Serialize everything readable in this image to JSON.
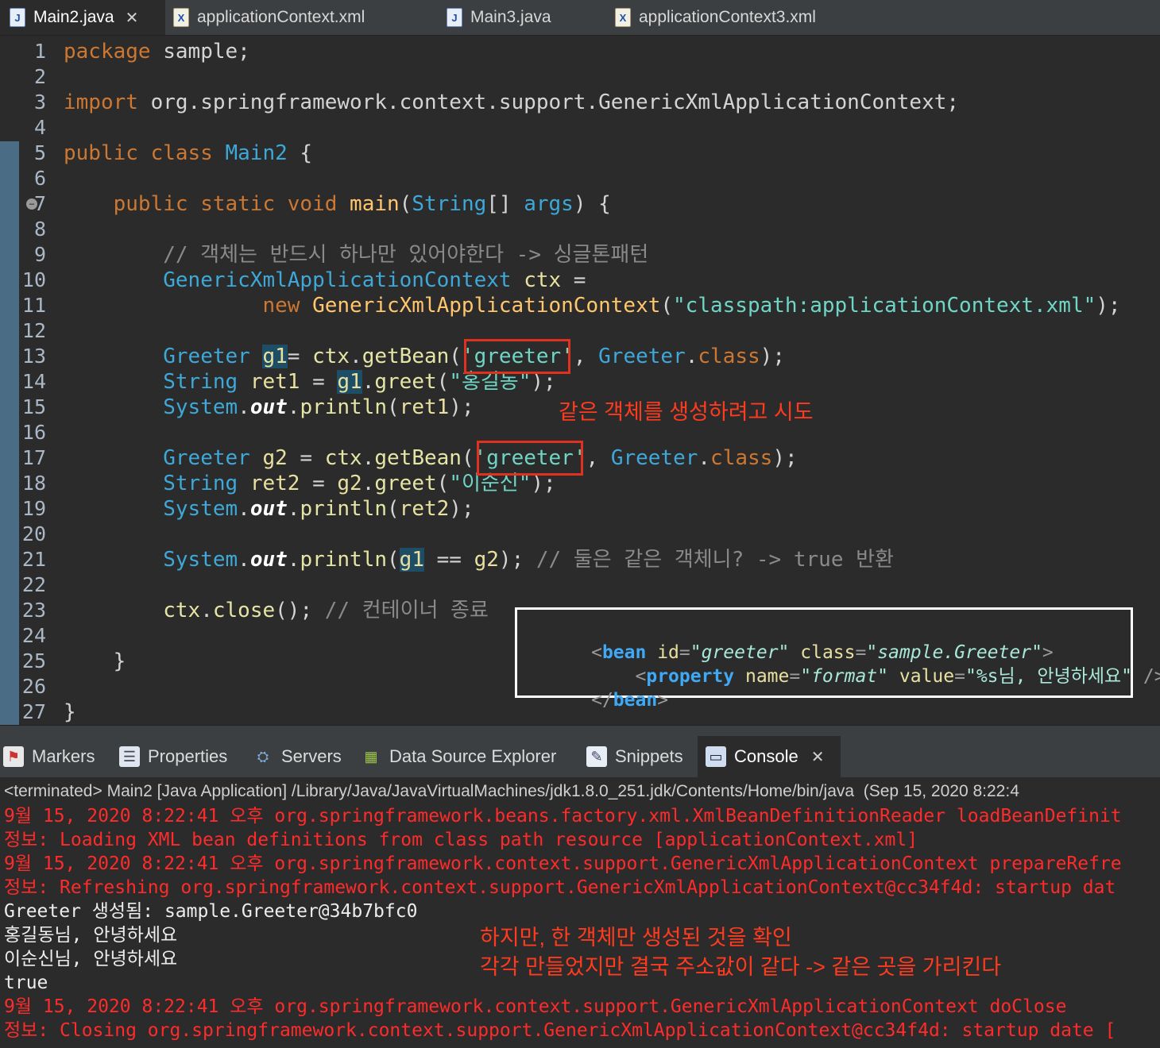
{
  "editor_tabs": [
    {
      "label": "Main2.java",
      "icon": "java-file-icon",
      "active": true
    },
    {
      "label": "applicationContext.xml",
      "icon": "xml-file-icon",
      "active": false
    },
    {
      "label": "Main3.java",
      "icon": "java-file-icon",
      "active": false
    },
    {
      "label": "applicationContext3.xml",
      "icon": "xml-file-icon",
      "active": false
    }
  ],
  "line_numbers": [
    "1",
    "2",
    "3",
    "4",
    "5",
    "6",
    "7",
    "8",
    "9",
    "10",
    "11",
    "12",
    "13",
    "14",
    "15",
    "16",
    "17",
    "18",
    "19",
    "20",
    "21",
    "22",
    "23",
    "24",
    "25",
    "26",
    "27"
  ],
  "code": {
    "l1": [
      "package",
      " sample;"
    ],
    "l3": [
      "import",
      " org.springframework.context.support.GenericXmlApplicationContext;"
    ],
    "l5": [
      "public class",
      " ",
      "Main2",
      " {"
    ],
    "l7": [
      "    ",
      "public static void",
      " ",
      "main",
      "(",
      "String",
      "[] ",
      "args",
      ") {"
    ],
    "l9": [
      "        // 객체는 반드시 하나만 있어야한다 -> 싱글톤패턴"
    ],
    "l10": [
      "        ",
      "GenericXmlApplicationContext",
      " ",
      "ctx",
      " ="
    ],
    "l11": [
      "                ",
      "new",
      " ",
      "GenericXmlApplicationContext",
      "(",
      "\"classpath:applicationContext.xml\"",
      ");"
    ],
    "l13": [
      "        ",
      "Greeter",
      " ",
      "g1",
      "= ",
      "ctx",
      ".",
      "getBean",
      "(",
      "'greeter'",
      ", ",
      "Greeter",
      ".",
      "class",
      ");"
    ],
    "l14": [
      "        ",
      "String",
      " ",
      "ret1",
      " = ",
      "g1",
      ".",
      "greet",
      "(",
      "\"홍길동\"",
      ");"
    ],
    "l15": [
      "        ",
      "System",
      ".",
      "out",
      ".",
      "println",
      "(",
      "ret1",
      ");"
    ],
    "l17": [
      "        ",
      "Greeter",
      " ",
      "g2",
      " = ",
      "ctx",
      ".",
      "getBean",
      "(",
      "'greeter'",
      ", ",
      "Greeter",
      ".",
      "class",
      ");"
    ],
    "l18": [
      "        ",
      "String",
      " ",
      "ret2",
      " = ",
      "g2",
      ".",
      "greet",
      "(",
      "\"이순신\"",
      ");"
    ],
    "l19": [
      "        ",
      "System",
      ".",
      "out",
      ".",
      "println",
      "(",
      "ret2",
      ");"
    ],
    "l21": [
      "        ",
      "System",
      ".",
      "out",
      ".",
      "println",
      "(",
      "g1",
      " == ",
      "g2",
      "); ",
      "// 둘은 같은 객체니? -> true 반환"
    ],
    "l23": [
      "        ",
      "ctx",
      ".",
      "close",
      "(); ",
      "// 컨테이너 종료"
    ],
    "l25": [
      "    }"
    ],
    "l27": [
      "}"
    ]
  },
  "annotations": {
    "same_object_attempt": "같은 객체를 생성하려고 시도",
    "console_note_1": "하지만, 한 객체만 생성된 것을 확인",
    "console_note_2": "각각 만들었지만 결국 주소값이 같다 -> 같은 곳을 가리킨다"
  },
  "xml_snippet": {
    "line1": [
      "<",
      "bean",
      " ",
      "id",
      "=",
      "\"greeter\"",
      " ",
      "class",
      "=",
      "\"sample.Greeter\"",
      ">"
    ],
    "line2": [
      "    <",
      "property",
      " ",
      "name",
      "=",
      "\"format\"",
      " ",
      "value",
      "=",
      "\"%s님, 안녕하세요\"",
      " />"
    ],
    "line3": [
      "</",
      "bean",
      ">"
    ]
  },
  "view_tabs": [
    {
      "label": "Markers",
      "icon": "markers-icon",
      "active": false
    },
    {
      "label": "Properties",
      "icon": "properties-icon",
      "active": false
    },
    {
      "label": "Servers",
      "icon": "servers-icon",
      "active": false
    },
    {
      "label": "Data Source Explorer",
      "icon": "data-source-explorer-icon",
      "active": false
    },
    {
      "label": "Snippets",
      "icon": "snippets-icon",
      "active": false
    },
    {
      "label": "Console",
      "icon": "console-icon",
      "active": true
    }
  ],
  "console": {
    "terminated": "<terminated> Main2 [Java Application] /Library/Java/JavaVirtualMachines/jdk1.8.0_251.jdk/Contents/Home/bin/java  (Sep 15, 2020 8:22:4",
    "lines": [
      {
        "text": "9월 15, 2020 8:22:41 오후 org.springframework.beans.factory.xml.XmlBeanDefinitionReader loadBeanDefinit",
        "kind": "err"
      },
      {
        "text": "정보: Loading XML bean definitions from class path resource [applicationContext.xml]",
        "kind": "err"
      },
      {
        "text": "9월 15, 2020 8:22:41 오후 org.springframework.context.support.GenericXmlApplicationContext prepareRefre",
        "kind": "err"
      },
      {
        "text": "정보: Refreshing org.springframework.context.support.GenericXmlApplicationContext@cc34f4d: startup dat",
        "kind": "err"
      },
      {
        "text": "Greeter 생성됨: sample.Greeter@34b7bfc0",
        "kind": "out"
      },
      {
        "text": "홍길동님, 안녕하세요",
        "kind": "out"
      },
      {
        "text": "이순신님, 안녕하세요",
        "kind": "out"
      },
      {
        "text": "true",
        "kind": "out"
      },
      {
        "text": "9월 15, 2020 8:22:41 오후 org.springframework.context.support.GenericXmlApplicationContext doClose",
        "kind": "err"
      },
      {
        "text": "정보: Closing org.springframework.context.support.GenericXmlApplicationContext@cc34f4d: startup date [",
        "kind": "err"
      }
    ]
  },
  "colors": {
    "editor_bg": "#2b2b2b",
    "keyword": "#cc7832",
    "type": "#3ea8d8",
    "string": "#6fd6c6",
    "annotation_red": "#ff3b1f",
    "console_error": "#ff2b2b"
  }
}
